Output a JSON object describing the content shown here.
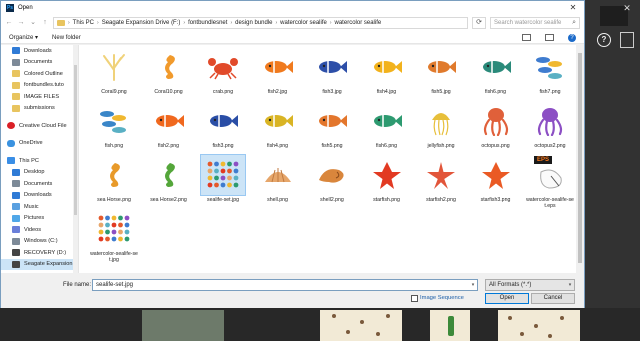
{
  "dialog": {
    "title": "Open",
    "app_icon": "Ps",
    "close_glyph": "✕"
  },
  "nav": {
    "back": "←",
    "forward": "→",
    "recent": "⌄",
    "up": "↑",
    "path": [
      "This PC",
      "Seagate Expansion Drive (F:)",
      "fontbundlesnet",
      "design bundle",
      "watercolor sealife",
      "watercolor sealife"
    ],
    "separator": "›",
    "search_placeholder": "Search watercolor sealife",
    "refresh": "⟳"
  },
  "toolbar": {
    "organize": "Organize ▾",
    "new_folder": "New folder",
    "help": "?"
  },
  "sidebar": {
    "items": [
      {
        "label": "Downloads",
        "icon": "downloads-icon",
        "cls": "blue",
        "indent": true
      },
      {
        "label": "Documents",
        "icon": "documents-icon",
        "cls": "drive",
        "indent": true
      },
      {
        "label": "Colored Outline",
        "icon": "folder-icon",
        "cls": "folder",
        "indent": true
      },
      {
        "label": "fontbundles.tuto",
        "icon": "folder-icon",
        "cls": "folder",
        "indent": true
      },
      {
        "label": "IMAGE FILES",
        "icon": "folder-icon",
        "cls": "folder",
        "indent": true
      },
      {
        "label": "submissions",
        "icon": "folder-icon",
        "cls": "folder",
        "indent": true
      },
      {
        "gap": true
      },
      {
        "label": "Creative Cloud File",
        "icon": "creative-cloud-icon",
        "cls": "cloud",
        "indent": false
      },
      {
        "gap": true
      },
      {
        "label": "OneDrive",
        "icon": "onedrive-icon",
        "cls": "onedrive",
        "indent": false
      },
      {
        "gap": true
      },
      {
        "label": "This PC",
        "icon": "this-pc-icon",
        "cls": "pc",
        "indent": false
      },
      {
        "label": "Desktop",
        "icon": "desktop-icon",
        "cls": "blue",
        "indent": true
      },
      {
        "label": "Documents",
        "icon": "documents-icon",
        "cls": "drive",
        "indent": true
      },
      {
        "label": "Downloads",
        "icon": "downloads-icon",
        "cls": "blue",
        "indent": true
      },
      {
        "label": "Music",
        "icon": "music-icon",
        "cls": "music",
        "indent": true
      },
      {
        "label": "Pictures",
        "icon": "pictures-icon",
        "cls": "pics",
        "indent": true
      },
      {
        "label": "Videos",
        "icon": "videos-icon",
        "cls": "video",
        "indent": true
      },
      {
        "label": "Windows (C:)",
        "icon": "drive-icon",
        "cls": "drive",
        "indent": true
      },
      {
        "label": "RECOVERY (D:)",
        "icon": "drive-icon",
        "cls": "drive-dark",
        "indent": true
      },
      {
        "label": "Seagate Expansion",
        "icon": "drive-icon",
        "cls": "drive-dark",
        "indent": true,
        "selected": true
      },
      {
        "gap": true
      },
      {
        "label": "Libraries",
        "icon": "libraries-icon",
        "cls": "libs",
        "indent": false
      }
    ]
  },
  "files": [
    {
      "name": "Coral9.png",
      "art": "coral",
      "color": "#f0d27a"
    },
    {
      "name": "Coral10.png",
      "art": "seahorse",
      "color": "#f19a2c"
    },
    {
      "name": "crab.png",
      "art": "crab",
      "color": "#e14a2a"
    },
    {
      "name": "fish2.jpg",
      "art": "fish",
      "color": "#f07a1e"
    },
    {
      "name": "fish3.jpg",
      "art": "fish",
      "color": "#2d4fa8"
    },
    {
      "name": "fish4.jpg",
      "art": "fish",
      "color": "#f2b21c"
    },
    {
      "name": "fish5.jpg",
      "art": "fish",
      "color": "#e07a2c"
    },
    {
      "name": "fish6.png",
      "art": "fish",
      "color": "#2a8a7a"
    },
    {
      "name": "fish7.png",
      "art": "school",
      "color": "#3f7ccf"
    },
    {
      "name": "fish.png",
      "art": "school",
      "color": "#3a86c8"
    },
    {
      "name": "fish2.png",
      "art": "fish",
      "color": "#f0681e"
    },
    {
      "name": "fish3.png",
      "art": "fish",
      "color": "#2a4ea6"
    },
    {
      "name": "fish4.png",
      "art": "fish",
      "color": "#d9b424"
    },
    {
      "name": "fish5.png",
      "art": "fish",
      "color": "#e3762c"
    },
    {
      "name": "fish6.png",
      "art": "fish",
      "color": "#2d9a70"
    },
    {
      "name": "jellyfish.png",
      "art": "jelly",
      "color": "#e7bf3a"
    },
    {
      "name": "octopus.png",
      "art": "octopus",
      "color": "#e0603a"
    },
    {
      "name": "octopus2.png",
      "art": "octopus",
      "color": "#8c4fc4"
    },
    {
      "name": "sea Horse.png",
      "art": "seahorse",
      "color": "#e89a2a"
    },
    {
      "name": "sea Horse2.png",
      "art": "seahorse",
      "color": "#54a63a"
    },
    {
      "name": "sealife-set.jpg",
      "art": "set",
      "color": "#7ab4d6",
      "selected": true
    },
    {
      "name": "shell.png",
      "art": "shell",
      "color": "#e6a66a"
    },
    {
      "name": "shell2.png",
      "art": "spiral",
      "color": "#d9863c"
    },
    {
      "name": "starfish.png",
      "art": "star",
      "color": "#e23a22"
    },
    {
      "name": "starfish2.png",
      "art": "star-thin",
      "color": "#e2553a"
    },
    {
      "name": "starfish3.png",
      "art": "star",
      "color": "#ea5a24"
    },
    {
      "name": "watercolor-sealife-set.eps",
      "art": "eps",
      "color": "#222222",
      "badge": "EPS"
    },
    {
      "name": "watercolor-sealife-set.jpg",
      "art": "set",
      "color": "#6fa7d4"
    }
  ],
  "footer": {
    "filename_label": "File name:",
    "filename_value": "sealife-set.jpg",
    "format_value": "All Formats (*.*)",
    "image_sequence": "Image Sequence",
    "open": "Open",
    "cancel": "Cancel",
    "dropdown": "▾"
  },
  "workspace": {
    "close": "✕",
    "help": "?"
  }
}
